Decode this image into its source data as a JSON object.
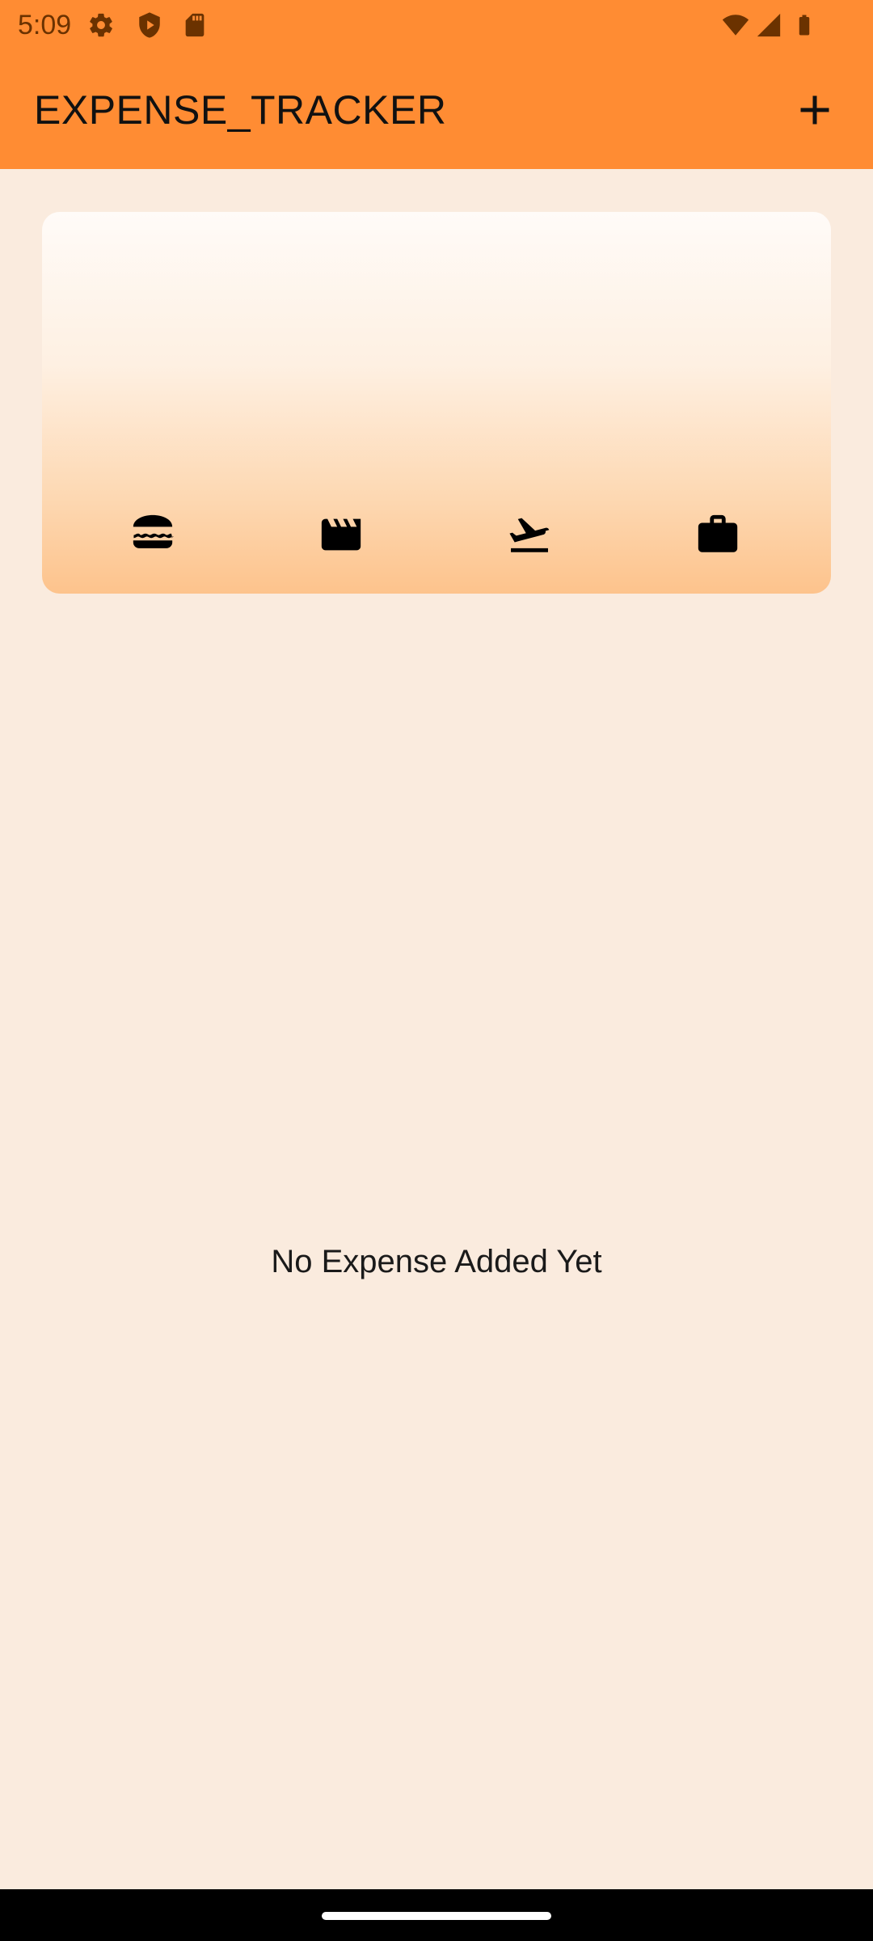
{
  "status_bar": {
    "time": "5:09",
    "left_icons": [
      "gear-icon",
      "shield-play-icon",
      "sd-card-icon"
    ],
    "right_icons": [
      "wifi-icon",
      "cellular-signal-icon",
      "battery-icon"
    ]
  },
  "app_bar": {
    "title": "EXPENSE_TRACKER",
    "add_icon": "plus-icon",
    "background": "#FF8C33"
  },
  "chart": {
    "categories": [
      {
        "icon": "food-burger-icon"
      },
      {
        "icon": "movie-clapper-icon"
      },
      {
        "icon": "flight-takeoff-icon"
      },
      {
        "icon": "work-briefcase-icon"
      }
    ]
  },
  "empty_state": {
    "message": "No Expense Added Yet"
  },
  "colors": {
    "accent": "#FF8C33",
    "background": "#FAEBDE"
  }
}
